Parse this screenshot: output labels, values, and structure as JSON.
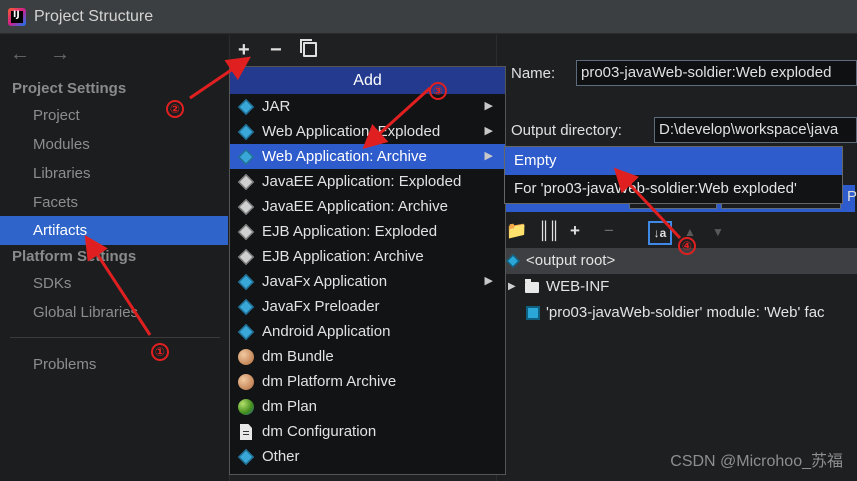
{
  "window": {
    "title": "Project Structure"
  },
  "sidebar": {
    "back": "←",
    "forward": "→",
    "project_settings_heading": "Project Settings",
    "project_items": [
      "Project",
      "Modules",
      "Libraries",
      "Facets",
      "Artifacts"
    ],
    "selected": "Artifacts",
    "platform_settings_heading": "Platform Settings",
    "platform_items": [
      "SDKs",
      "Global Libraries"
    ],
    "problems": "Problems"
  },
  "toolbar": {
    "add": "+",
    "remove": "−"
  },
  "add_menu": {
    "title": "Add",
    "items": [
      {
        "label": "JAR",
        "icon": "diamond-icon",
        "submenu": true
      },
      {
        "label": "Web Application: Exploded",
        "icon": "diamond-icon",
        "submenu": true
      },
      {
        "label": "Web Application: Archive",
        "icon": "diamond-icon",
        "submenu": true,
        "active": true
      },
      {
        "label": "JavaEE Application: Exploded",
        "icon": "javaee-icon",
        "submenu": false
      },
      {
        "label": "JavaEE Application: Archive",
        "icon": "javaee-icon",
        "submenu": false
      },
      {
        "label": "EJB Application: Exploded",
        "icon": "javaee-icon",
        "submenu": false
      },
      {
        "label": "EJB Application: Archive",
        "icon": "javaee-icon",
        "submenu": false
      },
      {
        "label": "JavaFx Application",
        "icon": "diamond-icon",
        "submenu": true
      },
      {
        "label": "JavaFx Preloader",
        "icon": "diamond-icon",
        "submenu": false
      },
      {
        "label": "Android Application",
        "icon": "diamond-icon",
        "submenu": false
      },
      {
        "label": "dm Bundle",
        "icon": "bundle-icon",
        "submenu": false
      },
      {
        "label": "dm Platform Archive",
        "icon": "bundle-icon",
        "submenu": false
      },
      {
        "label": "dm Plan",
        "icon": "plan-icon",
        "submenu": false
      },
      {
        "label": "dm Configuration",
        "icon": "document-icon",
        "submenu": false
      },
      {
        "label": "Other",
        "icon": "diamond-icon",
        "submenu": false
      }
    ]
  },
  "submenu": {
    "items": [
      "Empty",
      "For 'pro03-javaWeb-soldier:Web exploded'"
    ]
  },
  "details": {
    "name_label": "Name:",
    "name_value": "pro03-javaWeb-soldier:Web exploded",
    "output_label": "Output directory:",
    "output_value": "D:\\develop\\workspace\\java",
    "hidden_row_text": "P",
    "tree": {
      "root": "<output root>",
      "folder": "WEB-INF",
      "module": "'pro03-javaWeb-soldier' module: 'Web' fac"
    }
  },
  "annotations": {
    "steps": [
      "①",
      "②",
      "③",
      "④"
    ],
    "color": "#e02020"
  },
  "watermark": "CSDN @Microhoo_苏福"
}
